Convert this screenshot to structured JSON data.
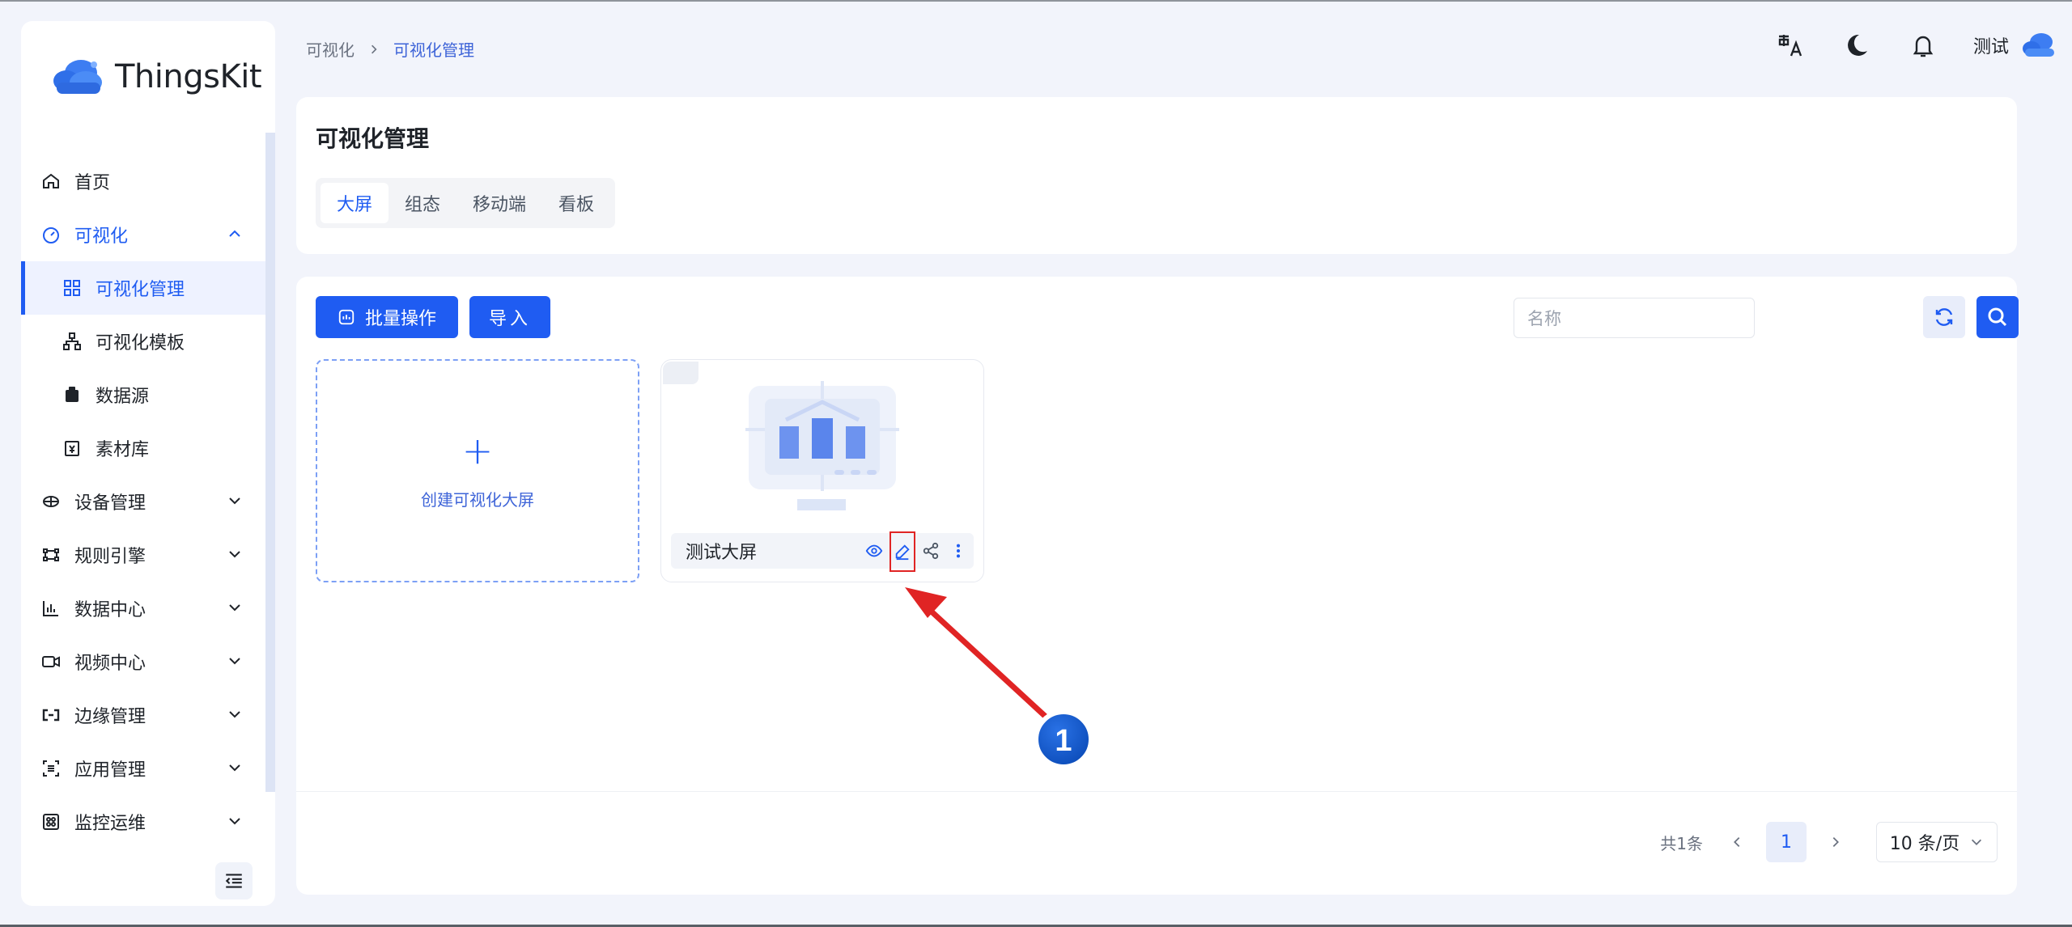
{
  "app": {
    "brand": "ThingsKit",
    "accent": "#1f5cf2"
  },
  "sidebar": {
    "items": [
      {
        "label": "首页",
        "icon": "home-icon"
      },
      {
        "label": "可视化",
        "icon": "dashboard-icon",
        "expanded": true
      },
      {
        "label": "可视化管理",
        "icon": "grid-icon",
        "active": true
      },
      {
        "label": "可视化模板",
        "icon": "sitemap-icon"
      },
      {
        "label": "数据源",
        "icon": "database-icon"
      },
      {
        "label": "素材库",
        "icon": "library-icon"
      },
      {
        "label": "设备管理",
        "icon": "device-icon"
      },
      {
        "label": "规则引擎",
        "icon": "rule-icon"
      },
      {
        "label": "数据中心",
        "icon": "chart-icon"
      },
      {
        "label": "视频中心",
        "icon": "video-icon"
      },
      {
        "label": "边缘管理",
        "icon": "edge-icon"
      },
      {
        "label": "应用管理",
        "icon": "app-icon"
      },
      {
        "label": "监控运维",
        "icon": "monitor-icon"
      }
    ]
  },
  "header": {
    "breadcrumb": [
      "可视化",
      "可视化管理"
    ],
    "username": "测试"
  },
  "page": {
    "title": "可视化管理",
    "tabs": [
      "大屏",
      "组态",
      "移动端",
      "看板"
    ]
  },
  "toolbar": {
    "batch_label": "批量操作",
    "import_label": "导入",
    "search_placeholder": "名称"
  },
  "cards": {
    "create_label": "创建可视化大屏",
    "plus": "+",
    "items": [
      {
        "name": "测试大屏"
      }
    ]
  },
  "pagination": {
    "total": "共1条",
    "current": "1",
    "page_size": "10 条/页"
  },
  "annotation": {
    "step": "1",
    "color": "#e02424"
  }
}
